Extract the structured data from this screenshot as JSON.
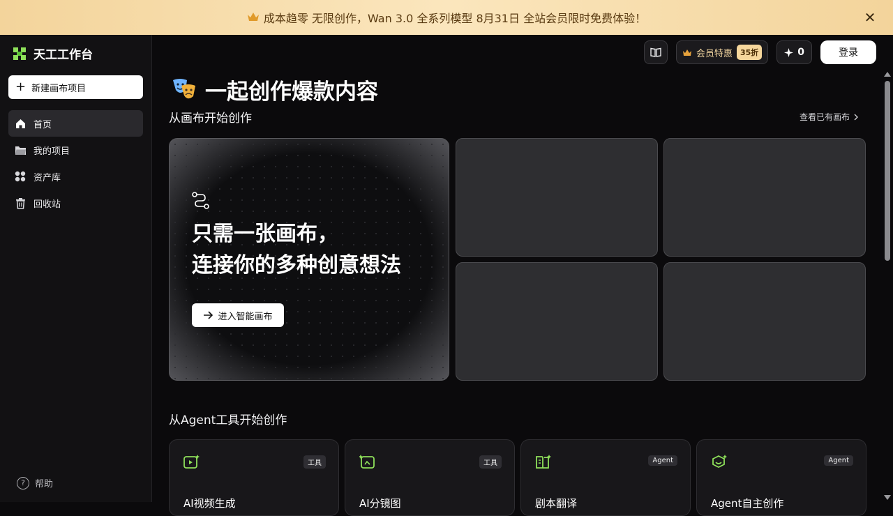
{
  "banner": {
    "text": "成本趋零 无限创作，Wan 3.0 全系列模型 8月31日 全站会员限时免费体验！",
    "crown_icon": "crown-icon",
    "close_glyph": "✕"
  },
  "sidebar": {
    "logo_text": "天工工作台",
    "new_project_label": "新建画布项目",
    "items": [
      {
        "label": "首页",
        "icon": "home-icon",
        "active": true
      },
      {
        "label": "我的项目",
        "icon": "folder-icon",
        "active": false
      },
      {
        "label": "资产库",
        "icon": "assets-icon",
        "active": false
      },
      {
        "label": "回收站",
        "icon": "trash-icon",
        "active": false
      }
    ],
    "help_label": "帮助"
  },
  "topbar": {
    "vip_label": "会员特惠",
    "discount_badge": "35折",
    "points": "0",
    "login_label": "登录"
  },
  "main": {
    "heading": "一起创作爆款内容",
    "section1_title": "从画布开始创作",
    "view_canvases_link": "查看已有画布",
    "hero": {
      "title_line1": "只需一张画布，",
      "title_line2": "连接你的多种创意想法",
      "enter_label": "进入智能画布"
    },
    "section2_title": "从Agent工具开始创作",
    "cards": [
      {
        "name": "AI视频生成",
        "tag": "工具"
      },
      {
        "name": "AI分镜图",
        "tag": "工具"
      },
      {
        "name": "剧本翻译",
        "tag": "Agent"
      },
      {
        "name": "Agent自主创作",
        "tag": "Agent"
      }
    ]
  },
  "colors": {
    "accent_green": "#8ee05a",
    "banner_bg": "#f7ddb0",
    "vip_gold": "#f6d79c"
  }
}
